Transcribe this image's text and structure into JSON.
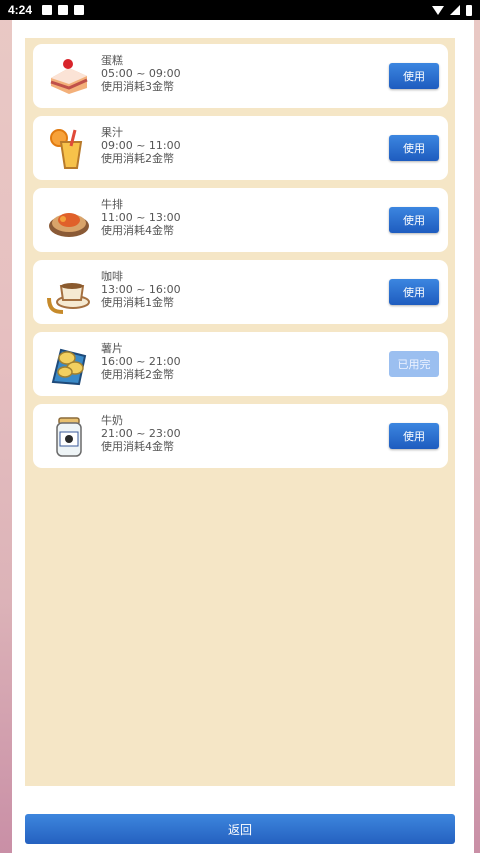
{
  "status_bar": {
    "time": "4:24"
  },
  "items": [
    {
      "name": "蛋糕",
      "time": "05:00 ~ 09:00",
      "cost": "使用消耗3金幣",
      "button": "使用",
      "state": "available",
      "icon": "cake-icon"
    },
    {
      "name": "果汁",
      "time": "09:00 ~ 11:00",
      "cost": "使用消耗2金幣",
      "button": "使用",
      "state": "available",
      "icon": "juice-icon"
    },
    {
      "name": "牛排",
      "time": "11:00 ~ 13:00",
      "cost": "使用消耗4金幣",
      "button": "使用",
      "state": "available",
      "icon": "steak-icon"
    },
    {
      "name": "咖啡",
      "time": "13:00 ~ 16:00",
      "cost": "使用消耗1金幣",
      "button": "使用",
      "state": "available",
      "icon": "coffee-icon"
    },
    {
      "name": "薯片",
      "time": "16:00 ~ 21:00",
      "cost": "使用消耗2金幣",
      "button": "已用完",
      "state": "used",
      "icon": "chips-icon"
    },
    {
      "name": "牛奶",
      "time": "21:00 ~ 23:00",
      "cost": "使用消耗4金幣",
      "button": "使用",
      "state": "available",
      "icon": "milk-icon"
    }
  ],
  "footer": {
    "return_label": "返回"
  },
  "colors": {
    "panel": "#f5e6c6",
    "button": "#2f72d4",
    "button_used": "#9bbff0"
  }
}
